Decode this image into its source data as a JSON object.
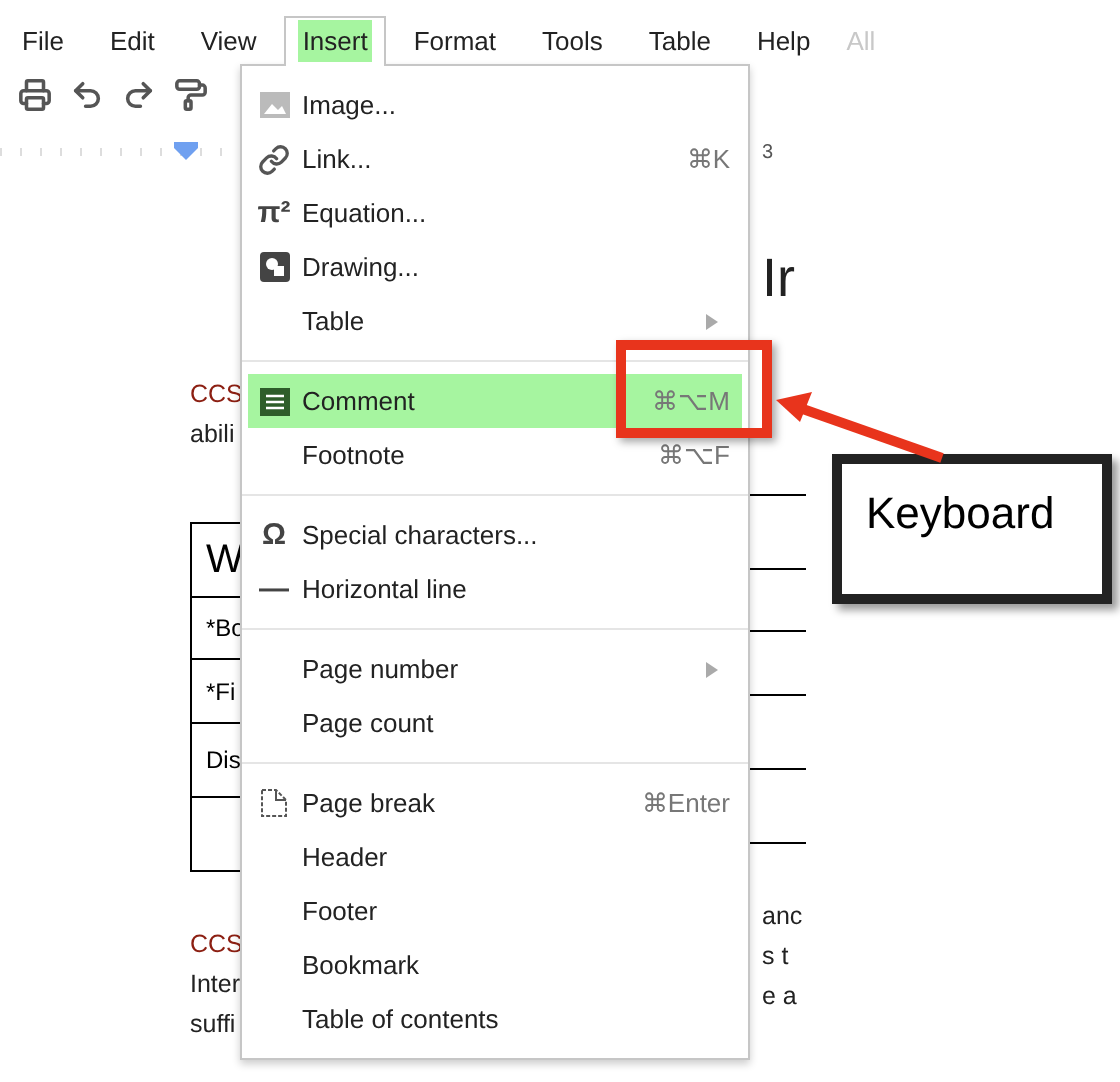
{
  "menubar": {
    "items": [
      {
        "label": "File",
        "selected": false
      },
      {
        "label": "Edit",
        "selected": false
      },
      {
        "label": "View",
        "selected": false
      },
      {
        "label": "Insert",
        "selected": true
      },
      {
        "label": "Format",
        "selected": false
      },
      {
        "label": "Tools",
        "selected": false
      },
      {
        "label": "Table",
        "selected": false
      },
      {
        "label": "Help",
        "selected": false
      }
    ],
    "status": "All"
  },
  "ruler": {
    "number": "3"
  },
  "document": {
    "heading": "Ir",
    "paragraph_1": {
      "left": [
        "CCS",
        "abili"
      ]
    },
    "table": {
      "rows": [
        {
          "kind": "title",
          "text": "W"
        },
        {
          "kind": "cell",
          "text": "*Bo"
        },
        {
          "kind": "cell",
          "text": "*Fi"
        },
        {
          "kind": "cell",
          "text": "Dis"
        },
        {
          "kind": "blank"
        }
      ]
    },
    "paragraph_2": {
      "left": [
        "CCS",
        "Inter",
        "suffi"
      ],
      "right": [
        "anc",
        "s t",
        "e a"
      ]
    }
  },
  "menu": {
    "items": [
      {
        "kind": "item",
        "label": "Image...",
        "selected": false
      },
      {
        "kind": "item",
        "label": "Link...",
        "shortcut": "⌘K",
        "selected": false
      },
      {
        "kind": "item",
        "label": "Equation...",
        "glyph": "π²",
        "selected": false
      },
      {
        "kind": "item",
        "label": "Drawing...",
        "selected": false
      },
      {
        "kind": "item",
        "label": "Table",
        "submenu": true,
        "selected": false
      },
      {
        "kind": "separator"
      },
      {
        "kind": "item",
        "label": "Comment",
        "shortcut": "⌘⌥M",
        "selected": true
      },
      {
        "kind": "item",
        "label": "Footnote",
        "shortcut": "⌘⌥F",
        "selected": false
      },
      {
        "kind": "separator"
      },
      {
        "kind": "item",
        "label": "Special characters...",
        "glyph": "Ω",
        "selected": false
      },
      {
        "kind": "item",
        "label": "Horizontal line",
        "glyph": "—",
        "selected": false
      },
      {
        "kind": "separator"
      },
      {
        "kind": "item",
        "label": "Page number",
        "submenu": true,
        "selected": false
      },
      {
        "kind": "item",
        "label": "Page count",
        "selected": false
      },
      {
        "kind": "separator"
      },
      {
        "kind": "item",
        "label": "Page break",
        "shortcut": "⌘Enter",
        "selected": false
      },
      {
        "kind": "item",
        "label": "Header",
        "selected": false
      },
      {
        "kind": "item",
        "label": "Footer",
        "selected": false
      },
      {
        "kind": "item",
        "label": "Bookmark",
        "selected": false
      },
      {
        "kind": "item",
        "label": "Table of contents",
        "selected": false
      }
    ]
  },
  "callout": {
    "label": "Keyboard"
  }
}
